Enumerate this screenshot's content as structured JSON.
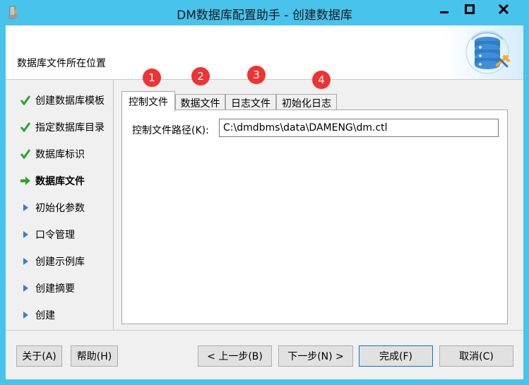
{
  "window": {
    "title": "DM数据库配置助手 - 创建数据库"
  },
  "header": {
    "title": "数据库文件所在位置"
  },
  "sidebar": {
    "steps": [
      {
        "label": "创建数据库模板",
        "state": "done",
        "icon": "check-icon"
      },
      {
        "label": "指定数据库目录",
        "state": "done",
        "icon": "check-icon"
      },
      {
        "label": "数据库标识",
        "state": "done",
        "icon": "check-icon"
      },
      {
        "label": "数据库文件",
        "state": "current",
        "icon": "arrow-right-icon"
      },
      {
        "label": "初始化参数",
        "state": "pending",
        "icon": "triangle-right-icon"
      },
      {
        "label": "口令管理",
        "state": "pending",
        "icon": "triangle-right-icon"
      },
      {
        "label": "创建示例库",
        "state": "pending",
        "icon": "triangle-right-icon"
      },
      {
        "label": "创建摘要",
        "state": "pending",
        "icon": "triangle-right-icon"
      },
      {
        "label": "创建",
        "state": "pending",
        "icon": "triangle-right-icon"
      }
    ]
  },
  "tabs": [
    {
      "label": "控制文件",
      "badge": "1",
      "active": true
    },
    {
      "label": "数据文件",
      "badge": "2",
      "active": false
    },
    {
      "label": "日志文件",
      "badge": "3",
      "active": false
    },
    {
      "label": "初始化日志",
      "badge": "4",
      "active": false
    }
  ],
  "control_file": {
    "label": "控制文件路径(K):",
    "value": "C:\\dmdbms\\data\\DAMENG\\dm.ctl"
  },
  "buttons": {
    "about": "关于(A)",
    "help": "帮助(H)",
    "prev": "< 上一步(B)",
    "next": "下一步(N) >",
    "finish": "完成(F)",
    "cancel": "取消(C)"
  },
  "colors": {
    "titlebar": "#48c3ec",
    "check": "#2aa52a",
    "arrow": "#2aa52a",
    "triangle": "#3a7bd5",
    "badge": "#ee3333"
  }
}
